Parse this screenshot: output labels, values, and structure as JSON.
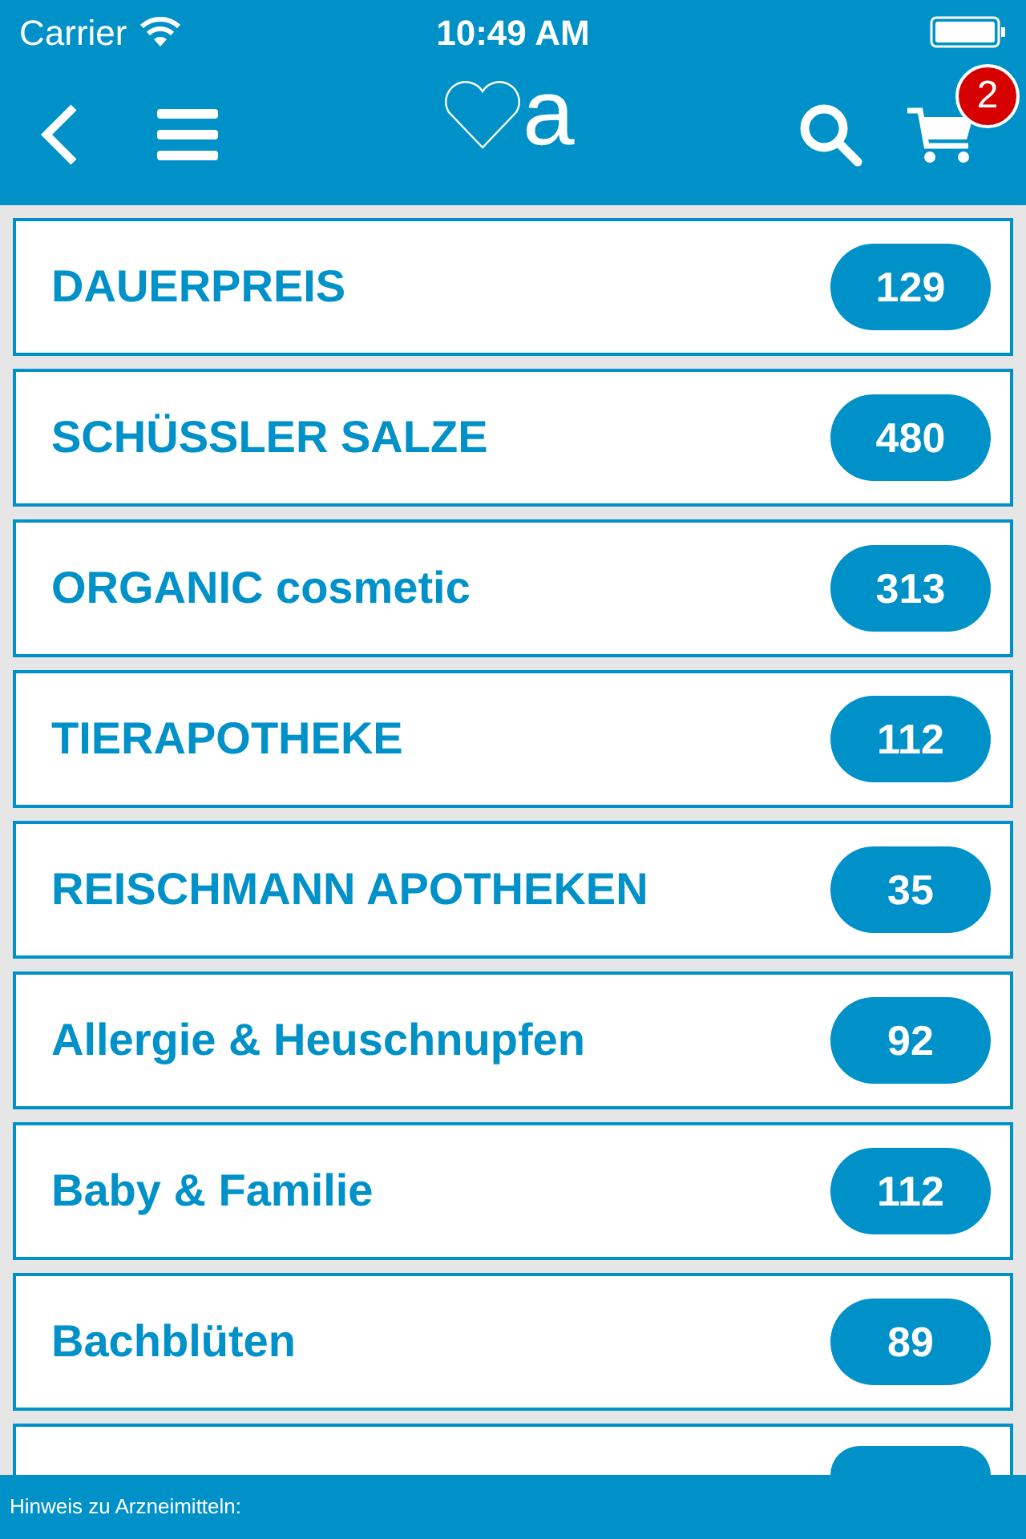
{
  "status_bar": {
    "carrier": "Carrier",
    "time": "10:49 AM"
  },
  "header": {
    "logo_letter": "a",
    "cart_count": "2"
  },
  "categories": [
    {
      "name": "DAUERPREIS",
      "count": "129"
    },
    {
      "name": "SCHÜSSLER SALZE",
      "count": "480"
    },
    {
      "name": "ORGANIC cosmetic",
      "count": "313"
    },
    {
      "name": "TIERAPOTHEKE",
      "count": "112"
    },
    {
      "name": "REISCHMANN APOTHEKEN",
      "count": "35"
    },
    {
      "name": "Allergie & Heuschnupfen",
      "count": "92"
    },
    {
      "name": "Baby & Familie",
      "count": "112"
    },
    {
      "name": "Bachblüten",
      "count": "89"
    }
  ],
  "footer": {
    "text": "Hinweis zu Arzneimitteln:"
  }
}
